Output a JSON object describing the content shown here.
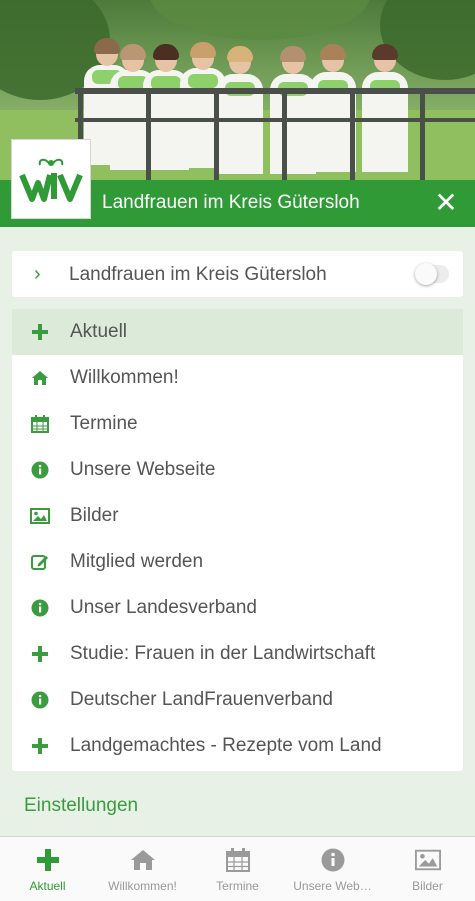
{
  "colors": {
    "accent": "#2f9a36",
    "background": "#e8f1e6",
    "active_row": "#dcebd9",
    "text": "#555555",
    "tab_inactive": "#999999"
  },
  "header": {
    "image": "group-photo",
    "logo": "lv-logo",
    "title": "Landfrauen im Kreis Gütersloh",
    "close_icon": "close-icon"
  },
  "project": {
    "label": "Landfrauen im Kreis Gütersloh",
    "chevron_icon": "chevron-right-icon",
    "toggle_on": false
  },
  "menu": {
    "items": [
      {
        "label": "Aktuell",
        "icon": "plus-icon",
        "active": true
      },
      {
        "label": "Willkommen!",
        "icon": "home-icon",
        "active": false
      },
      {
        "label": "Termine",
        "icon": "calendar-icon",
        "active": false
      },
      {
        "label": "Unsere Webseite",
        "icon": "info-icon",
        "active": false
      },
      {
        "label": "Bilder",
        "icon": "image-icon",
        "active": false
      },
      {
        "label": "Mitglied werden",
        "icon": "edit-icon",
        "active": false
      },
      {
        "label": "Unser Landesverband",
        "icon": "info-icon",
        "active": false
      },
      {
        "label": "Studie: Frauen in der Landwirtschaft",
        "icon": "plus-icon",
        "active": false
      },
      {
        "label": "Deutscher LandFrauenverband",
        "icon": "info-icon",
        "active": false
      },
      {
        "label": "Landgemachtes - Rezepte vom Land",
        "icon": "plus-icon",
        "active": false
      }
    ]
  },
  "settings": {
    "label": "Einstellungen"
  },
  "tabs": [
    {
      "label": "Aktuell",
      "icon": "plus-icon",
      "active": true
    },
    {
      "label": "Willkommen!",
      "icon": "home-icon",
      "active": false
    },
    {
      "label": "Termine",
      "icon": "calendar-icon",
      "active": false
    },
    {
      "label": "Unsere Web…",
      "icon": "info-icon",
      "active": false
    },
    {
      "label": "Bilder",
      "icon": "image-icon",
      "active": false
    }
  ]
}
